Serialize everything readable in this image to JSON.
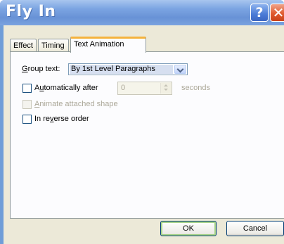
{
  "window": {
    "title": "Fly In",
    "help_glyph": "?",
    "close_glyph": "✕"
  },
  "tabs": [
    {
      "label": "Effect",
      "active": false
    },
    {
      "label": "Timing",
      "active": false
    },
    {
      "label": "Text Animation",
      "active": true
    }
  ],
  "text_animation": {
    "group_text": {
      "label_accel": "G",
      "label_rest": "roup text:",
      "value": "By 1st Level Paragraphs"
    },
    "auto_after": {
      "label_pre": "A",
      "label_accel": "u",
      "label_post": "tomatically after",
      "checked": false,
      "value": "0",
      "unit": "seconds"
    },
    "animate_shape": {
      "label_accel": "A",
      "label_rest": "nimate attached shape",
      "checked": false,
      "enabled": false
    },
    "reverse": {
      "label_pre": "In re",
      "label_accel": "v",
      "label_post": "erse order",
      "checked": false
    }
  },
  "buttons": {
    "ok": "OK",
    "cancel": "Cancel"
  },
  "colors": {
    "title_bar": "#6f9dd8",
    "dialog_bg": "#ece9d8",
    "active_tab_accent": "#f5b33d",
    "close_button": "#e05a2e"
  }
}
